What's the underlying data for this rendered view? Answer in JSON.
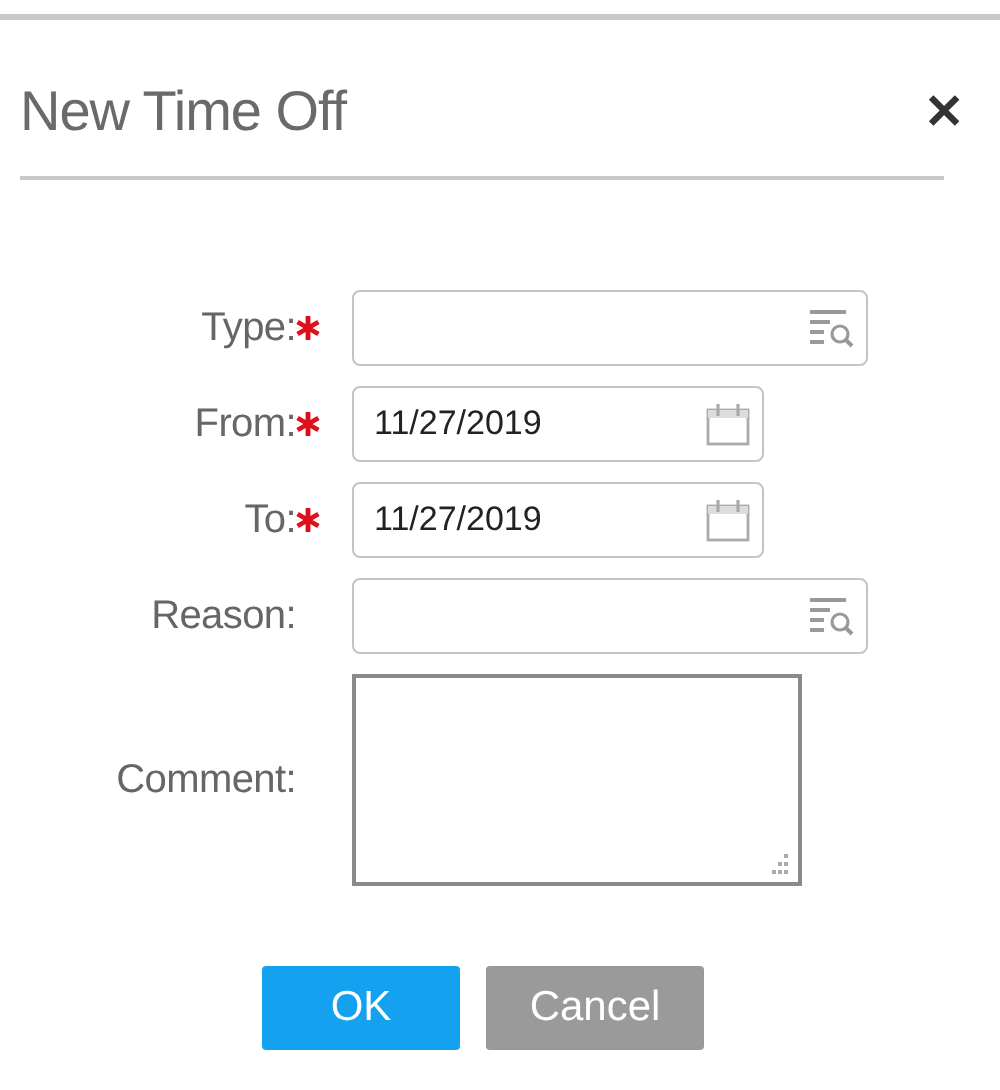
{
  "dialog": {
    "title": "New Time Off",
    "close": "✕"
  },
  "fields": [
    {
      "label": "Type:",
      "kind": "lookup",
      "required": true
    },
    {
      "label": "From:",
      "kind": "date",
      "required": true,
      "value": "11/27/2019"
    },
    {
      "label": "To:",
      "kind": "date",
      "required": true,
      "value": "11/27/2019"
    },
    {
      "label": "Reason:",
      "kind": "lookup",
      "required": false
    },
    {
      "label": "Comment:",
      "kind": "textarea",
      "required": false
    }
  ],
  "buttons": [
    {
      "label": "OK",
      "kind": "primary"
    },
    {
      "label": "Cancel",
      "kind": "secondary"
    }
  ]
}
